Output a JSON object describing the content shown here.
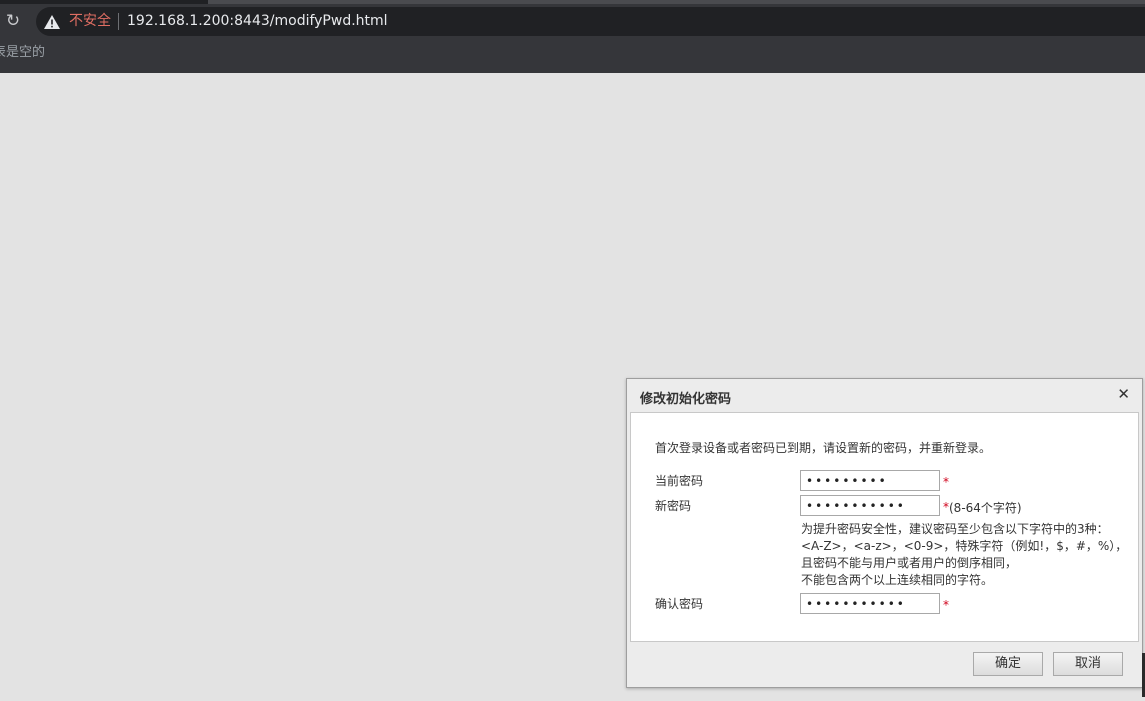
{
  "browser": {
    "insecure_label": "不安全",
    "url": "192.168.1.200:8443/modifyPwd.html",
    "bookmarks_empty_text": "表是空的",
    "reload_icon": "reload-icon",
    "warning_icon": "warning-triangle-icon"
  },
  "dialog": {
    "title": "修改初始化密码",
    "close_icon": "close-icon",
    "info": "首次登录设备或者密码已到期，请设置新的密码，并重新登录。",
    "current_password": {
      "label": "当前密码",
      "value": "•••••••••"
    },
    "new_password": {
      "label": "新密码",
      "value": "•••••••••••",
      "length_hint": "(8-64个字符)"
    },
    "hint_lines": [
      "为提升密码安全性，建议密码至少包含以下字符中的3种：",
      "<A-Z>，<a-z>，<0-9>，特殊字符（例如!，$，#，%），",
      "且密码不能与用户或者用户的倒序相同，",
      "不能包含两个以上连续相同的字符。"
    ],
    "confirm_password": {
      "label": "确认密码",
      "value": "•••••••••••"
    },
    "required_mark": "*",
    "ok_button": "确定",
    "cancel_button": "取消"
  },
  "colors": {
    "chrome": "#35363a",
    "omnibox": "#202124",
    "insecure": "#e06e63",
    "page_background": "#e3e3e3",
    "required": "#d0021b"
  }
}
